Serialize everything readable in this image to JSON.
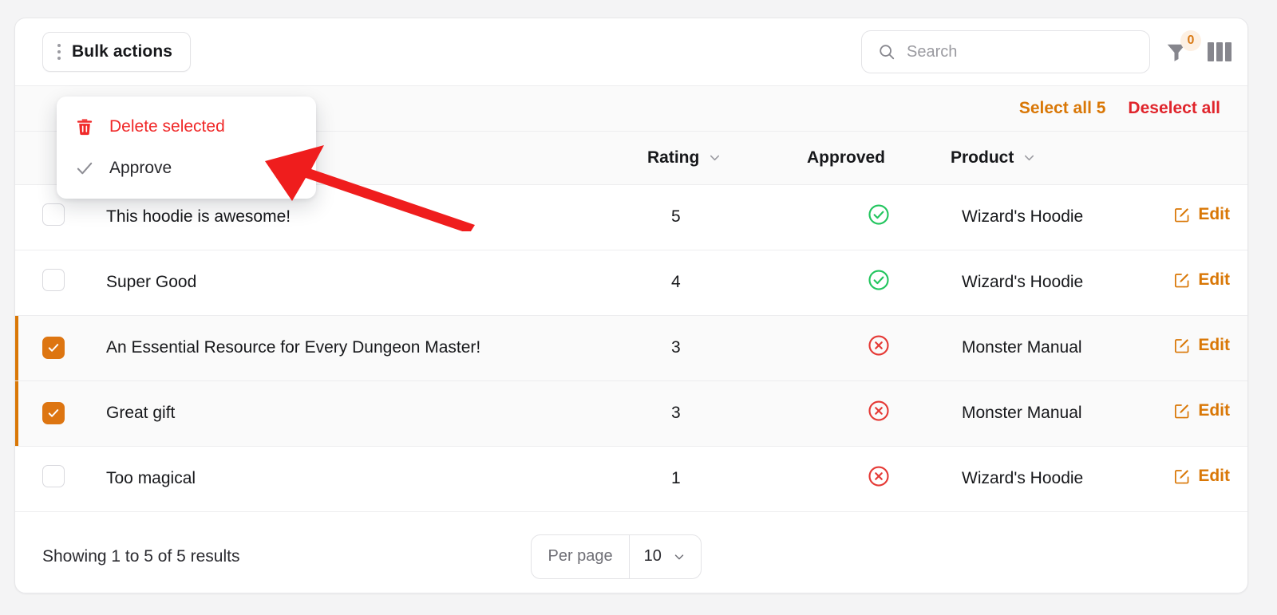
{
  "toolbar": {
    "bulk_actions_label": "Bulk actions",
    "kebab_icon": "kebab-menu-icon",
    "search": {
      "placeholder": "Search",
      "value": "",
      "icon": "search-icon"
    },
    "filter": {
      "icon": "filter-funnel-icon",
      "badge_count": "0"
    },
    "columns": {
      "icon": "columns-icon"
    }
  },
  "dropdown": {
    "open": true,
    "items": [
      {
        "label": "Delete selected",
        "icon": "trash-icon",
        "tone": "danger"
      },
      {
        "label": "Approve",
        "icon": "check-icon",
        "tone": "normal"
      }
    ]
  },
  "selection_bar": {
    "select_all_label": "Select all 5",
    "deselect_all_label": "Deselect all"
  },
  "table": {
    "columns": [
      {
        "key": "checkbox",
        "label": "",
        "sortable": false
      },
      {
        "key": "title",
        "label": "",
        "sortable": false
      },
      {
        "key": "rating",
        "label": "Rating",
        "sortable": true
      },
      {
        "key": "approved",
        "label": "Approved",
        "sortable": false
      },
      {
        "key": "product",
        "label": "Product",
        "sortable": true
      },
      {
        "key": "edit",
        "label": "",
        "sortable": false
      }
    ],
    "rows": [
      {
        "selected": false,
        "title": "This hoodie is awesome!",
        "rating": "5",
        "approved": true,
        "product": "Wizard's Hoodie",
        "edit_label": "Edit"
      },
      {
        "selected": false,
        "title": "Super Good",
        "rating": "4",
        "approved": true,
        "product": "Wizard's Hoodie",
        "edit_label": "Edit"
      },
      {
        "selected": true,
        "title": "An Essential Resource for Every Dungeon Master!",
        "rating": "3",
        "approved": false,
        "product": "Monster Manual",
        "edit_label": "Edit"
      },
      {
        "selected": true,
        "title": "Great gift",
        "rating": "3",
        "approved": false,
        "product": "Monster Manual",
        "edit_label": "Edit"
      },
      {
        "selected": false,
        "title": "Too magical",
        "rating": "1",
        "approved": false,
        "product": "Wizard's Hoodie",
        "edit_label": "Edit"
      }
    ]
  },
  "footer": {
    "showing_text": "Showing 1 to 5 of 5 results",
    "per_page_label": "Per page",
    "per_page_value": "10"
  },
  "annotation": {
    "arrow_icon": "red-arrow-pointer",
    "color": "#ef1d1d"
  },
  "colors": {
    "accent_orange": "#d97706",
    "checkbox_orange": "#dd7511",
    "danger_red": "#e0242b",
    "delete_red": "#f02929",
    "approved_green": "#22c55e",
    "rejected_red": "#e53935"
  }
}
